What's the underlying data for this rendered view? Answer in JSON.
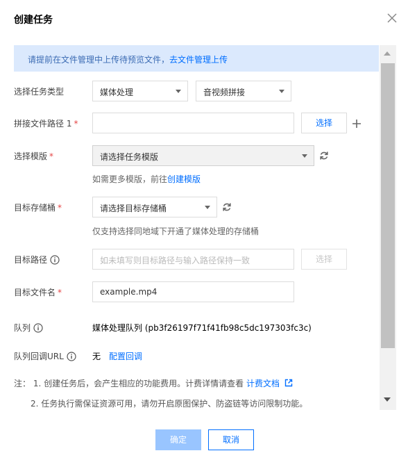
{
  "dialog": {
    "title": "创建任务",
    "close_icon": "close-icon"
  },
  "tip": {
    "text": "请提前在文件管理中上传待预览文件，",
    "link": "去文件管理上传"
  },
  "form": {
    "task_type": {
      "label": "选择任务类型",
      "category": "媒体处理",
      "subtype": "音视频拼接"
    },
    "concat_path": {
      "label": "拼接文件路径 1",
      "required": "*",
      "value": "",
      "select_button": "选择",
      "add_icon": "plus-icon"
    },
    "template": {
      "label": "选择模版",
      "required": "*",
      "placeholder": "请选择任务模版",
      "refresh_icon": "refresh-icon",
      "hint_prefix": "如需更多模版，前往",
      "hint_link": "创建模版"
    },
    "bucket": {
      "label": "目标存储桶",
      "required": "*",
      "placeholder": "请选择目标存储桶",
      "refresh_icon": "refresh-icon",
      "hint": "仅支持选择同地域下开通了媒体处理的存储桶"
    },
    "target_path": {
      "label": "目标路径",
      "info_icon": "info-icon",
      "placeholder": "如未填写则目标路径与输入路径保持一致",
      "select_button": "选择"
    },
    "target_filename": {
      "label": "目标文件名",
      "required": "*",
      "value": "example.mp4"
    },
    "queue": {
      "label": "队列",
      "info_icon": "info-icon",
      "value": "媒体处理队列 (pb3f26197f71f41fb98c5dc197303fc3c)"
    },
    "callback_url": {
      "label": "队列回调URL",
      "info_icon": "info-icon",
      "value": "无",
      "link": "配置回调"
    }
  },
  "notes": {
    "prefix": "注：",
    "line1_text": "1. 创建任务后，会产生相应的功能费用。计费详情请查看",
    "line1_link": "计费文档",
    "external_icon": "external-link-icon",
    "line2_text": "2. 任务执行需保证资源可用，请勿开启原图保护、防盗链等访问限制功能。"
  },
  "footer": {
    "confirm": "确定",
    "cancel": "取消"
  },
  "colors": {
    "accent": "#006eff",
    "tip_bg": "#dbe9fd",
    "required": "#e54545",
    "confirm_disabled": "#99c5ff"
  }
}
